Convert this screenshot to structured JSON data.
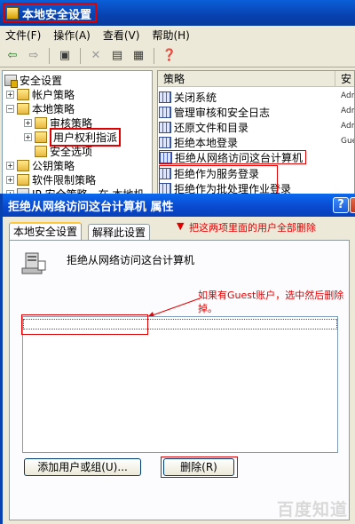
{
  "mmc": {
    "title": "本地安全设置",
    "menu": [
      "文件(F)",
      "操作(A)",
      "查看(V)",
      "帮助(H)"
    ],
    "toolbar_icons": [
      "back-arrow-icon",
      "forward-arrow-icon",
      "up-folder-icon",
      "delete-x-icon",
      "properties-icon",
      "export-list-icon",
      "help-icon"
    ],
    "tree": [
      {
        "label": "安全设置",
        "level": 0,
        "expander": "-"
      },
      {
        "label": "帐户策略",
        "level": 1,
        "expander": "+"
      },
      {
        "label": "本地策略",
        "level": 1,
        "expander": "-"
      },
      {
        "label": "审核策略",
        "level": 2,
        "expander": "+"
      },
      {
        "label": "用户权利指派",
        "level": 2,
        "expander": "+"
      },
      {
        "label": "安全选项",
        "level": 2,
        "expander": ""
      },
      {
        "label": "公钥策略",
        "level": 1,
        "expander": "+"
      },
      {
        "label": "软件限制策略",
        "level": 1,
        "expander": "+"
      },
      {
        "label": "IP 安全策略，在 本地机",
        "level": 1,
        "expander": "+"
      }
    ],
    "list_headers": {
      "policy": "策略",
      "setting": "安"
    },
    "list": [
      {
        "name": "关闭系统",
        "setting": "Adm"
      },
      {
        "name": "管理审核和安全日志",
        "setting": "Adm"
      },
      {
        "name": "还原文件和目录",
        "setting": "Adm"
      },
      {
        "name": "拒绝本地登录",
        "setting": "Gue"
      },
      {
        "name": "拒绝从网络访问这台计算机",
        "setting": ""
      },
      {
        "name": "拒绝作为服务登录",
        "setting": ""
      },
      {
        "name": "拒绝作为批处理作业登录",
        "setting": ""
      }
    ]
  },
  "dialog": {
    "title": "拒绝从网络访问这台计算机 属性",
    "help_label": "?",
    "tabs": [
      "本地安全设置",
      "解释此设置"
    ],
    "policy_name": "拒绝从网络访问这台计算机",
    "add_button": "添加用户或组(U)...",
    "remove_button": "删除(R)"
  },
  "annotations": {
    "remove_all": "把这两项里面的用户全部删除",
    "guest_note_line1": "如果有Guest账户，选中然后删除",
    "guest_note_line2": "掉。"
  },
  "watermark": "百度知道",
  "colors": {
    "annotation": "#e00000",
    "xp_blue": "#0842b0"
  }
}
